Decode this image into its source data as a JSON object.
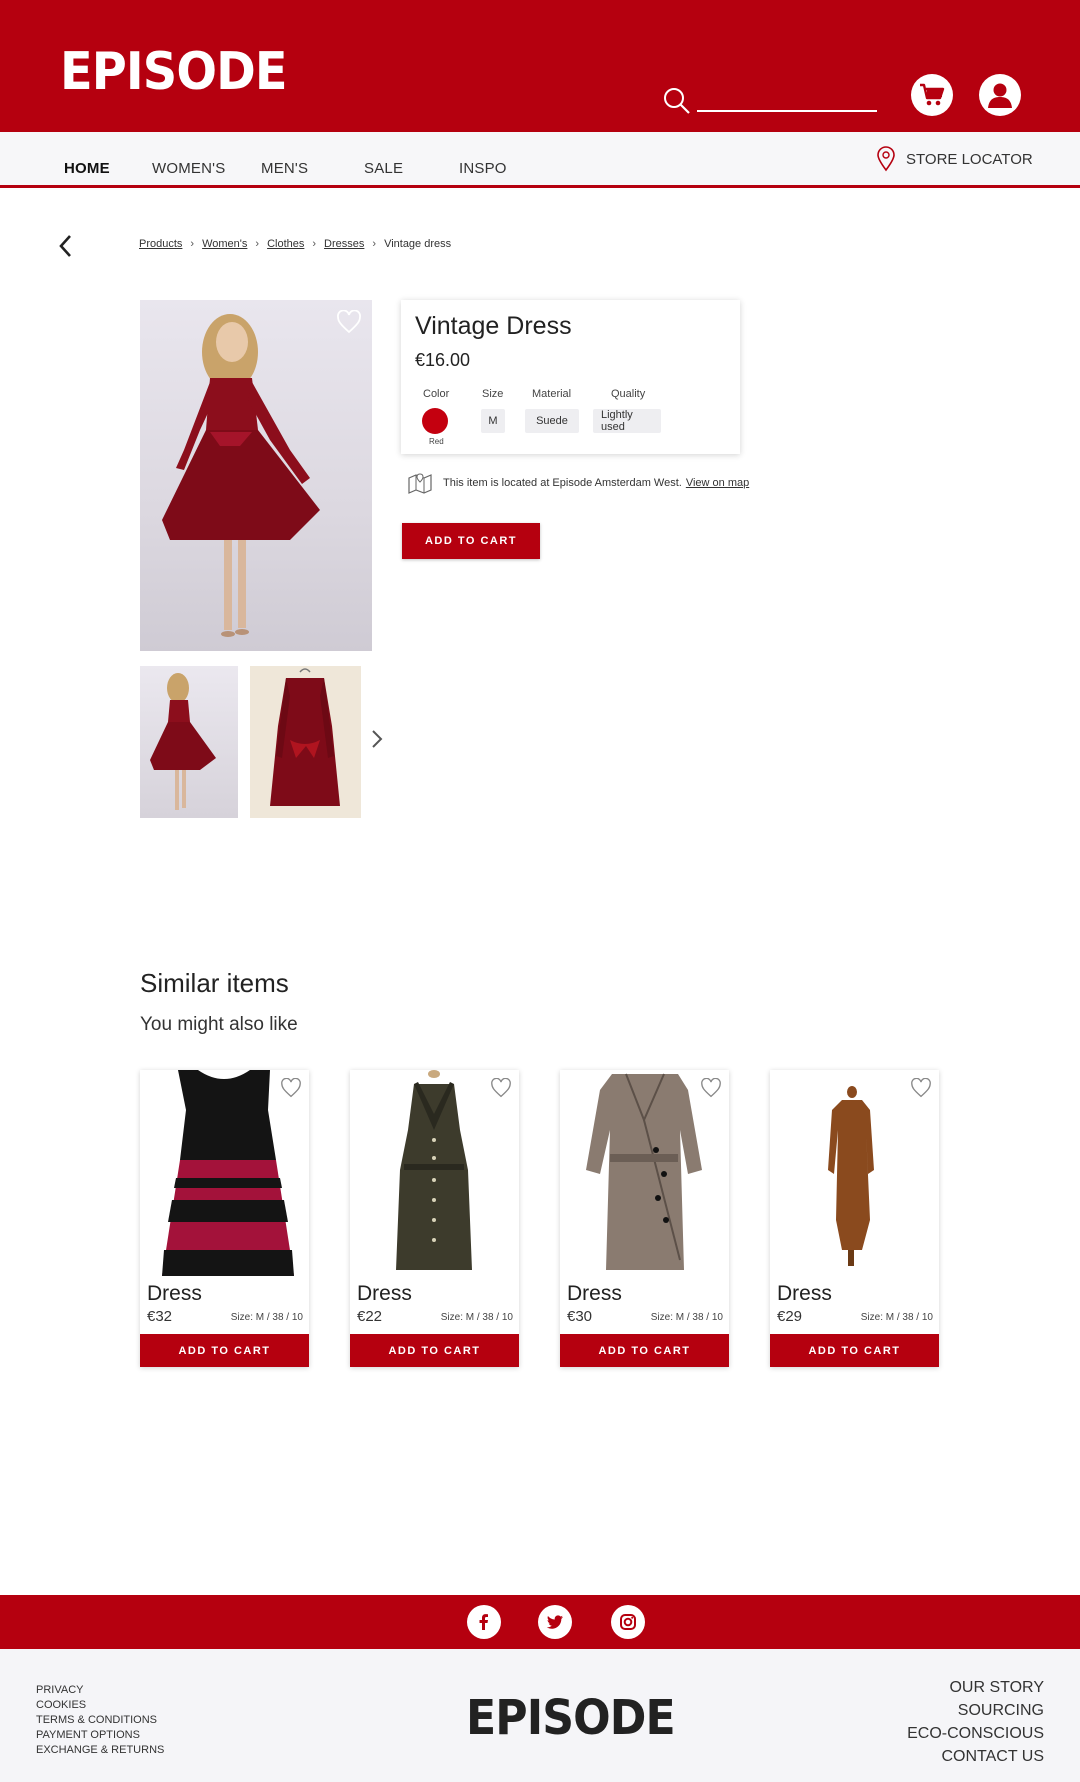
{
  "header": {
    "logo": "EPISODE",
    "search_placeholder": "",
    "cart_icon": "cart-icon",
    "account_icon": "user-icon"
  },
  "nav": {
    "items": [
      {
        "label": "HOME",
        "active": true
      },
      {
        "label": "WOMEN'S"
      },
      {
        "label": "MEN'S"
      },
      {
        "label": "SALE"
      },
      {
        "label": "INSPO"
      }
    ],
    "store_locator": "STORE LOCATOR"
  },
  "breadcrumb": {
    "items": [
      "Products",
      "Women's",
      "Clothes",
      "Dresses"
    ],
    "current": "Vintage dress"
  },
  "product": {
    "title": "Vintage Dress",
    "price": "€16.00",
    "attributes": {
      "color_label": "Color",
      "color_value": "Red",
      "size_label": "Size",
      "size_value": "M",
      "material_label": "Material",
      "material_value": "Suede",
      "quality_label": "Quality",
      "quality_value": "Lightly used"
    },
    "location_text": "This item is located at Episode Amsterdam West.",
    "location_link": "View on map",
    "add_to_cart": "ADD TO CART"
  },
  "similar": {
    "title": "Similar items",
    "subtitle": "You might also like",
    "items": [
      {
        "name": "Dress",
        "price": "€32",
        "size": "Size: M / 38 / 10",
        "button": "ADD TO CART"
      },
      {
        "name": "Dress",
        "price": "€22",
        "size": "Size: M / 38 / 10",
        "button": "ADD TO CART"
      },
      {
        "name": "Dress",
        "price": "€30",
        "size": "Size: M / 38 / 10",
        "button": "ADD TO CART"
      },
      {
        "name": "Dress",
        "price": "€29",
        "size": "Size: M / 38 / 10",
        "button": "ADD TO CART"
      }
    ]
  },
  "footer": {
    "social": [
      "facebook-icon",
      "twitter-icon",
      "instagram-icon"
    ],
    "left_links": [
      "PRIVACY",
      "COOKIES",
      "TERMS & CONDITIONS",
      "PAYMENT OPTIONS",
      "EXCHANGE & RETURNS"
    ],
    "logo": "EPISODE",
    "right_links": [
      "OUR STORY",
      "SOURCING",
      "ECO-CONSCIOUS",
      "CONTACT US"
    ]
  },
  "colors": {
    "brand_red": "#b5000f",
    "swatch_red": "#c4000f"
  }
}
